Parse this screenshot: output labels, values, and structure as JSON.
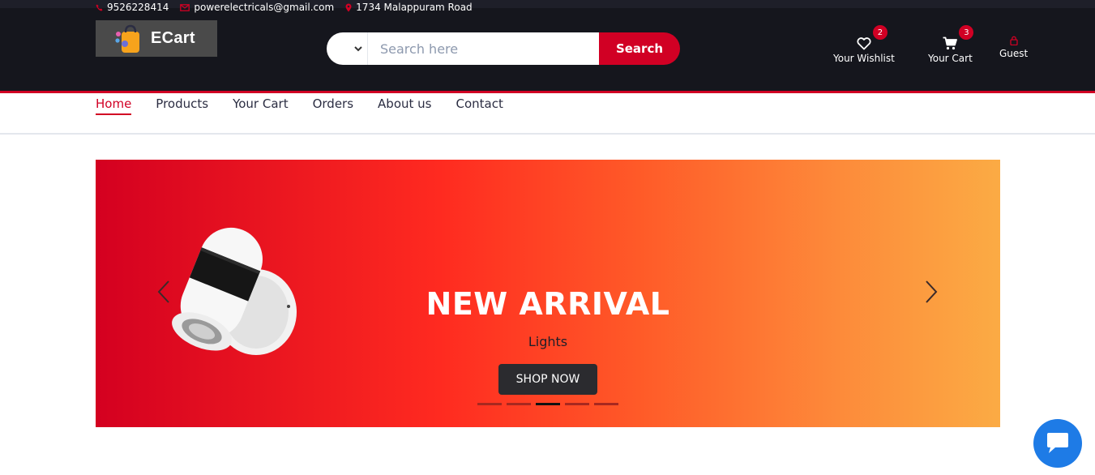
{
  "topbar": {
    "phone": "9526228414",
    "email": "powerelectricals@gmail.com",
    "address": "1734 Malappuram Road"
  },
  "header": {
    "logo_text": "ECart",
    "search": {
      "placeholder": "Search here",
      "button_label": "Search"
    },
    "wishlist": {
      "label": "Your Wishlist",
      "count": "2"
    },
    "cart": {
      "label": "Your Cart",
      "count": "3"
    },
    "account": {
      "label": "Guest"
    }
  },
  "nav": {
    "items": [
      {
        "label": "Home",
        "active": true
      },
      {
        "label": "Products"
      },
      {
        "label": "Your Cart"
      },
      {
        "label": "Orders"
      },
      {
        "label": "About us"
      },
      {
        "label": "Contact"
      }
    ]
  },
  "carousel": {
    "title": "NEW ARRIVAL",
    "subtitle": "Lights",
    "button_label": "SHOP NOW",
    "slide_count": 5,
    "active_slide": 3
  },
  "colors": {
    "accent": "#d10024",
    "header_bg": "#15161d",
    "chat_button": "#1e7be6"
  },
  "icons": [
    "phone-icon",
    "mail-icon",
    "location-icon",
    "shopping-bag-icon",
    "chevron-down-icon",
    "heart-icon",
    "cart-icon",
    "user-icon",
    "chevron-left-icon",
    "chevron-right-icon",
    "chat-icon"
  ]
}
